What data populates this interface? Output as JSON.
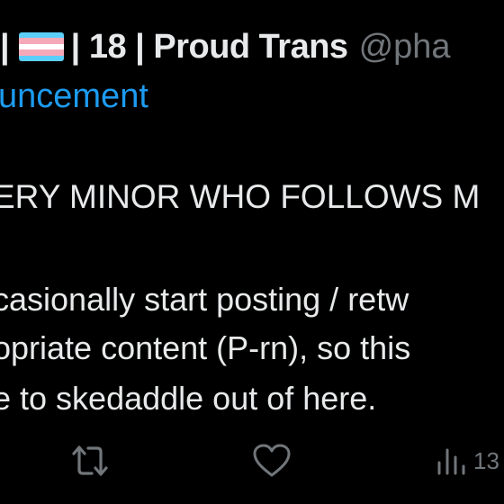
{
  "header": {
    "name_start": "|",
    "flag_icon": "transgender-flag-icon",
    "flag_colors": [
      "#5bcefa",
      "#f5a9b8",
      "#ffffff",
      "#f5a9b8",
      "#5bcefa"
    ],
    "name_rest": "| 18 | Proud Trans",
    "handle": "@pha"
  },
  "link_text": "uncement",
  "body": {
    "line1": "ERY MINOR WHO FOLLOWS M",
    "line2": "casionally start posting / retw",
    "line3": "opriate content (P-rn), so this",
    "line4": "e to skedaddle out of here."
  },
  "actions": {
    "retweet_icon": "retweet-icon",
    "like_icon": "heart-icon",
    "views_icon": "views-icon",
    "views_count": "13"
  },
  "colors": {
    "background": "#000000",
    "text": "#e7e9ea",
    "secondary": "#71767b",
    "link": "#1d9bf0"
  }
}
